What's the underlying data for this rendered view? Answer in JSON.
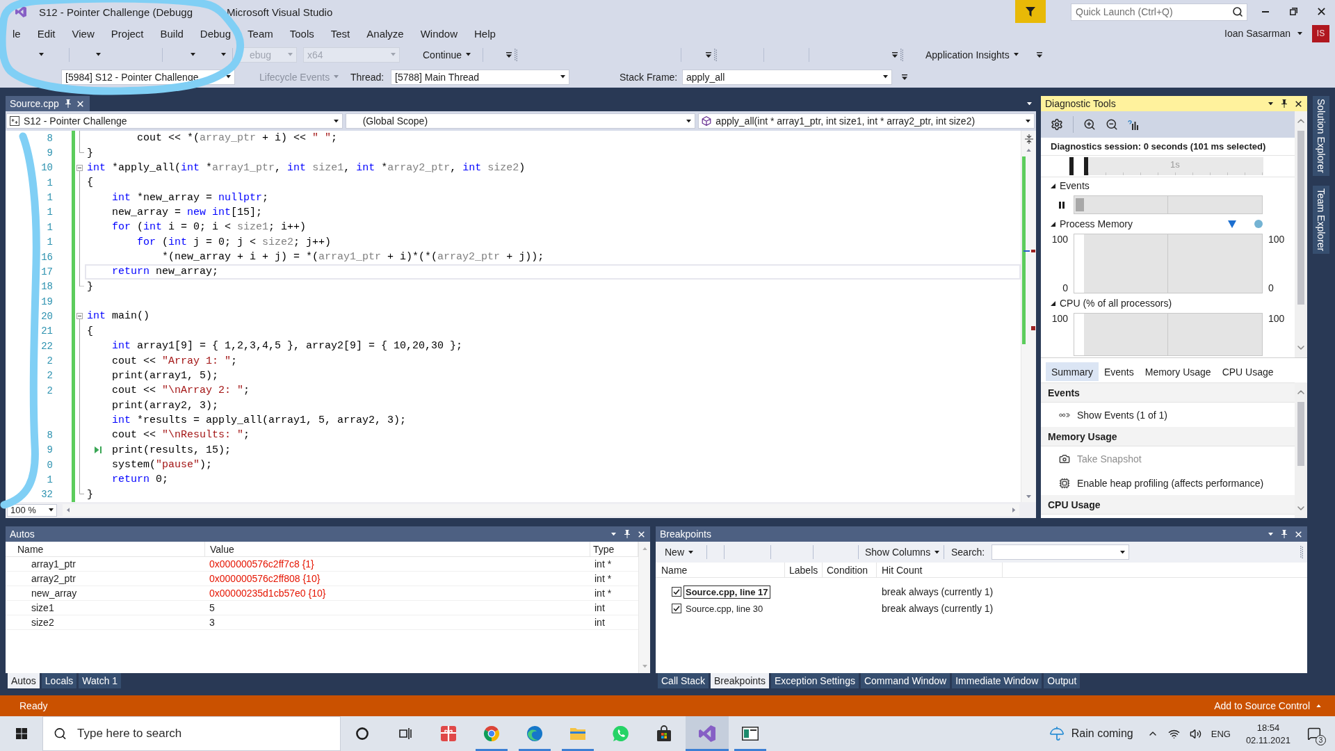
{
  "window": {
    "title_fragments": [
      "S12 - Pointer Challenge (Debugg",
      "Microsoft Visual Studio"
    ],
    "quick_launch": {
      "placeholder": "Quick Launch (Ctrl+Q)"
    }
  },
  "menu": [
    "le",
    "Edit",
    "View",
    "Project",
    "Build",
    "Debug",
    "Team",
    "Tools",
    "Test",
    "Analyze",
    "Window",
    "Help"
  ],
  "account": {
    "name": "Ioan Sasarman",
    "initials": "IS"
  },
  "debug_toolbar": {
    "configuration": {
      "value": "ebug",
      "disabled": true
    },
    "platform": {
      "value": "x64",
      "disabled": true
    },
    "continue": "Continue",
    "insights": "Application Insights"
  },
  "debug_location": {
    "process": "[5984] S12 - Pointer Challenge",
    "lifecycle": {
      "label": "Lifecycle Events",
      "disabled": true
    },
    "thread_label": "Thread:",
    "thread": "[5788] Main Thread",
    "frame_label": "Stack Frame:",
    "frame": "apply_all"
  },
  "editor": {
    "tabs": [
      {
        "label": "Source.cpp",
        "selected": true
      }
    ],
    "nav": {
      "project": "S12 - Pointer Challenge",
      "scope": "(Global Scope)",
      "member": "apply_all(int * array1_ptr, int size1, int * array2_ptr, int size2)"
    },
    "lines": [
      {
        "number": "8",
        "changed": true,
        "caret": false,
        "run_to_click": false,
        "fold": {
          "kind": "body"
        },
        "tokens": [
          {
            "kind": "plain",
            "text": "        cout << *("
          },
          {
            "kind": "param",
            "text": "array_ptr"
          },
          {
            "kind": "plain",
            "text": " + i) << "
          },
          {
            "kind": "string",
            "text": "\" \""
          },
          {
            "kind": "plain",
            "text": ";"
          }
        ]
      },
      {
        "number": "9",
        "changed": true,
        "caret": false,
        "run_to_click": false,
        "fold": {
          "kind": "end"
        },
        "tokens": [
          {
            "kind": "plain",
            "text": "}"
          }
        ]
      },
      {
        "number": "10",
        "changed": true,
        "caret": false,
        "run_to_click": false,
        "fold": {
          "kind": "start",
          "expanded": true
        },
        "tokens": [
          {
            "kind": "keyword",
            "text": "int"
          },
          {
            "kind": "plain",
            "text": " *apply_all("
          },
          {
            "kind": "keyword",
            "text": "int"
          },
          {
            "kind": "plain",
            "text": " *"
          },
          {
            "kind": "param",
            "text": "array1_ptr"
          },
          {
            "kind": "plain",
            "text": ", "
          },
          {
            "kind": "keyword",
            "text": "int "
          },
          {
            "kind": "param",
            "text": "size1"
          },
          {
            "kind": "plain",
            "text": ", "
          },
          {
            "kind": "keyword",
            "text": "int"
          },
          {
            "kind": "plain",
            "text": " *"
          },
          {
            "kind": "param",
            "text": "array2_ptr"
          },
          {
            "kind": "plain",
            "text": ", "
          },
          {
            "kind": "keyword",
            "text": "int "
          },
          {
            "kind": "param",
            "text": "size2"
          },
          {
            "kind": "plain",
            "text": ")"
          }
        ]
      },
      {
        "number": "1",
        "changed": true,
        "caret": false,
        "run_to_click": false,
        "fold": {
          "kind": "body"
        },
        "tokens": [
          {
            "kind": "plain",
            "text": "{"
          }
        ]
      },
      {
        "number": "1",
        "changed": true,
        "caret": false,
        "run_to_click": false,
        "fold": {
          "kind": "body"
        },
        "tokens": [
          {
            "kind": "keyword",
            "text": "    int"
          },
          {
            "kind": "plain",
            "text": " *new_array = "
          },
          {
            "kind": "keyword",
            "text": "nullptr"
          },
          {
            "kind": "plain",
            "text": ";"
          }
        ]
      },
      {
        "number": "1",
        "changed": true,
        "caret": false,
        "run_to_click": false,
        "fold": {
          "kind": "body"
        },
        "tokens": [
          {
            "kind": "plain",
            "text": "    new_array = "
          },
          {
            "kind": "keyword",
            "text": "new int"
          },
          {
            "kind": "plain",
            "text": "[15];"
          }
        ]
      },
      {
        "number": "1",
        "changed": true,
        "caret": false,
        "run_to_click": false,
        "fold": {
          "kind": "body"
        },
        "tokens": [
          {
            "kind": "keyword",
            "text": "    for"
          },
          {
            "kind": "plain",
            "text": " ("
          },
          {
            "kind": "keyword",
            "text": "int"
          },
          {
            "kind": "plain",
            "text": " i = 0; i < "
          },
          {
            "kind": "param",
            "text": "size1"
          },
          {
            "kind": "plain",
            "text": "; i++)"
          }
        ]
      },
      {
        "number": "1",
        "changed": true,
        "caret": false,
        "run_to_click": false,
        "fold": {
          "kind": "body"
        },
        "tokens": [
          {
            "kind": "keyword",
            "text": "        for"
          },
          {
            "kind": "plain",
            "text": " ("
          },
          {
            "kind": "keyword",
            "text": "int"
          },
          {
            "kind": "plain",
            "text": " j = 0; j < "
          },
          {
            "kind": "param",
            "text": "size2"
          },
          {
            "kind": "plain",
            "text": "; j++)"
          }
        ]
      },
      {
        "number": "16",
        "changed": true,
        "caret": false,
        "run_to_click": false,
        "fold": {
          "kind": "body"
        },
        "tokens": [
          {
            "kind": "plain",
            "text": "            *(new_array + i + j) = *("
          },
          {
            "kind": "param",
            "text": "array1_ptr"
          },
          {
            "kind": "plain",
            "text": " + i)*(*("
          },
          {
            "kind": "param",
            "text": "array2_ptr"
          },
          {
            "kind": "plain",
            "text": " + j));"
          }
        ]
      },
      {
        "number": "17",
        "changed": true,
        "caret": true,
        "run_to_click": false,
        "fold": {
          "kind": "body"
        },
        "tokens": [
          {
            "kind": "keyword",
            "text": "    return"
          },
          {
            "kind": "plain",
            "text": " new_array;"
          }
        ]
      },
      {
        "number": "18",
        "changed": true,
        "caret": false,
        "run_to_click": false,
        "fold": {
          "kind": "end"
        },
        "tokens": [
          {
            "kind": "plain",
            "text": "}"
          }
        ]
      },
      {
        "number": "19",
        "changed": true,
        "caret": false,
        "run_to_click": false
      },
      {
        "number": "20",
        "changed": true,
        "caret": false,
        "run_to_click": false,
        "fold": {
          "kind": "start",
          "expanded": true
        },
        "tokens": [
          {
            "kind": "keyword",
            "text": "int"
          },
          {
            "kind": "plain",
            "text": " main()"
          }
        ]
      },
      {
        "number": "21",
        "changed": true,
        "caret": false,
        "run_to_click": false,
        "fold": {
          "kind": "body"
        },
        "tokens": [
          {
            "kind": "plain",
            "text": "{"
          }
        ]
      },
      {
        "number": "22",
        "changed": true,
        "caret": false,
        "run_to_click": false,
        "fold": {
          "kind": "body"
        },
        "tokens": [
          {
            "kind": "keyword",
            "text": "    int"
          },
          {
            "kind": "plain",
            "text": " array1[9] = { 1,2,3,4,5 }, array2[9] = { 10,20,30 };"
          }
        ]
      },
      {
        "number": "2",
        "changed": true,
        "caret": false,
        "run_to_click": false,
        "fold": {
          "kind": "body"
        },
        "tokens": [
          {
            "kind": "plain",
            "text": "    cout << "
          },
          {
            "kind": "string",
            "text": "\"Array 1: \""
          },
          {
            "kind": "plain",
            "text": ";"
          }
        ]
      },
      {
        "number": "2",
        "changed": true,
        "caret": false,
        "run_to_click": false,
        "fold": {
          "kind": "body"
        },
        "tokens": [
          {
            "kind": "plain",
            "text": "    print(array1, 5);"
          }
        ]
      },
      {
        "number": "2",
        "changed": true,
        "caret": false,
        "run_to_click": false,
        "fold": {
          "kind": "body"
        },
        "tokens": [
          {
            "kind": "plain",
            "text": "    cout << "
          },
          {
            "kind": "string",
            "text": "\"\\nArray 2: \""
          },
          {
            "kind": "plain",
            "text": ";"
          }
        ]
      },
      {
        "changed": true,
        "caret": false,
        "run_to_click": false,
        "fold": {
          "kind": "body"
        },
        "tokens": [
          {
            "kind": "plain",
            "text": "    print(array2, 3);"
          }
        ]
      },
      {
        "changed": true,
        "caret": false,
        "run_to_click": false,
        "fold": {
          "kind": "body"
        },
        "tokens": [
          {
            "kind": "keyword",
            "text": "    int"
          },
          {
            "kind": "plain",
            "text": " *results = apply_all(array1, 5, array2, 3);"
          }
        ]
      },
      {
        "number": "8",
        "changed": true,
        "caret": false,
        "run_to_click": false,
        "fold": {
          "kind": "body"
        },
        "tokens": [
          {
            "kind": "plain",
            "text": "    cout << "
          },
          {
            "kind": "string",
            "text": "\"\\nResults: \""
          },
          {
            "kind": "plain",
            "text": ";"
          }
        ]
      },
      {
        "number": "9",
        "changed": true,
        "caret": false,
        "run_to_click": true,
        "fold": {
          "kind": "body"
        },
        "tokens": [
          {
            "kind": "plain",
            "text": "    print(results, 15);"
          }
        ]
      },
      {
        "number": "0",
        "changed": true,
        "caret": false,
        "run_to_click": false,
        "fold": {
          "kind": "body"
        },
        "tokens": [
          {
            "kind": "plain",
            "text": "    system("
          },
          {
            "kind": "string",
            "text": "\"pause\""
          },
          {
            "kind": "plain",
            "text": ");"
          }
        ]
      },
      {
        "number": "1",
        "changed": true,
        "caret": false,
        "run_to_click": false,
        "fold": {
          "kind": "body"
        },
        "tokens": [
          {
            "kind": "keyword",
            "text": "    return"
          },
          {
            "kind": "plain",
            "text": " 0;"
          }
        ]
      },
      {
        "number": "32",
        "changed": true,
        "caret": false,
        "run_to_click": false,
        "fold": {
          "kind": "end"
        },
        "tokens": [
          {
            "kind": "plain",
            "text": "}"
          }
        ]
      }
    ],
    "zoom": "100 %"
  },
  "diagnostic_tools": {
    "title": "Diagnostic Tools",
    "active": true,
    "session": "Diagnostics session: 0 seconds (101 ms selected)",
    "ruler_label": "1s",
    "graphs": [
      {
        "kind": "events",
        "label": "Events",
        "expanded": true
      },
      {
        "kind": "memory",
        "label": "Process Memory",
        "expanded": true,
        "left_axis": [
          "100",
          "0"
        ],
        "right_axis": [
          "100",
          "0"
        ]
      },
      {
        "kind": "cpu",
        "label": "CPU (% of all processors)",
        "expanded": true,
        "left_axis": [
          "100"
        ],
        "right_axis": [
          "100"
        ]
      }
    ],
    "tabs": [
      {
        "label": "Summary",
        "selected": true
      },
      {
        "label": "Events",
        "selected": false
      },
      {
        "label": "Memory Usage",
        "selected": false
      },
      {
        "label": "CPU Usage",
        "selected": false
      }
    ],
    "sections": [
      {
        "title": "Events",
        "items": [
          {
            "kind": "events",
            "label": "Show Events (1 of 1)",
            "disabled": false
          }
        ]
      },
      {
        "title": "Memory Usage",
        "items": [
          {
            "kind": "snapshot",
            "label": "Take Snapshot",
            "disabled": true
          },
          {
            "kind": "heap",
            "label": "Enable heap profiling (affects performance)",
            "disabled": false
          }
        ]
      },
      {
        "title": "CPU Usage"
      }
    ]
  },
  "side_tabs": [
    "Solution Explorer",
    "Team Explorer"
  ],
  "autos": {
    "title": "Autos",
    "active": false,
    "columns": [
      "Name",
      "Value",
      "Type"
    ],
    "rows": [
      {
        "name": "array1_ptr",
        "value": "0x000000576c2ff7c8 {1}",
        "type": "int *",
        "changed": true
      },
      {
        "name": "array2_ptr",
        "value": "0x000000576c2ff808 {10}",
        "type": "int *",
        "changed": true
      },
      {
        "name": "new_array",
        "value": "0x00000235d1cb57e0 {10}",
        "type": "int *",
        "changed": true
      },
      {
        "name": "size1",
        "value": "5",
        "type": "int",
        "changed": false
      },
      {
        "name": "size2",
        "value": "3",
        "type": "int",
        "changed": false
      }
    ],
    "tabs": [
      {
        "label": "Autos",
        "selected": true
      },
      {
        "label": "Locals",
        "selected": false
      },
      {
        "label": "Watch 1",
        "selected": false
      }
    ]
  },
  "breakpoints": {
    "title": "Breakpoints",
    "active": false,
    "new_button": "New",
    "columns_button": "Show Columns",
    "search_label": "Search:",
    "columns": [
      "Name",
      "Labels",
      "Condition",
      "Hit Count"
    ],
    "rows": [
      {
        "name": "Source.cpp, line 17",
        "hit_count": "break always (currently 1)",
        "checked": true,
        "current": true,
        "selected": true
      },
      {
        "name": "Source.cpp, line 30",
        "hit_count": "break always (currently 1)",
        "checked": true,
        "current": false,
        "selected": false
      }
    ],
    "tabs": [
      {
        "label": "Call Stack",
        "selected": false
      },
      {
        "label": "Breakpoints",
        "selected": true
      },
      {
        "label": "Exception Settings",
        "selected": false
      },
      {
        "label": "Command Window",
        "selected": false
      },
      {
        "label": "Immediate Window",
        "selected": false
      },
      {
        "label": "Output",
        "selected": false
      }
    ]
  },
  "status_bar": {
    "text": "Ready",
    "source_control": "Add to Source Control"
  },
  "taskbar": {
    "search": {
      "placeholder": "Type here to search"
    },
    "apps": [
      {
        "kind": "cortana",
        "running": false,
        "selected": false
      },
      {
        "kind": "task_view",
        "running": false,
        "selected": false
      },
      {
        "kind": "gift",
        "running": false,
        "selected": false
      },
      {
        "kind": "chrome",
        "running": true,
        "selected": false
      },
      {
        "kind": "edge",
        "running": true,
        "selected": false
      },
      {
        "kind": "files",
        "running": true,
        "selected": false
      },
      {
        "kind": "whatsapp",
        "running": false,
        "selected": false
      },
      {
        "kind": "store",
        "running": false,
        "selected": false
      },
      {
        "kind": "visual_studio",
        "running": true,
        "selected": true
      },
      {
        "kind": "app",
        "running": true,
        "selected": false
      }
    ],
    "weather": "Rain coming",
    "language": "ENG",
    "time": "18:54",
    "date": "02.11.2021",
    "notifications": "3"
  }
}
